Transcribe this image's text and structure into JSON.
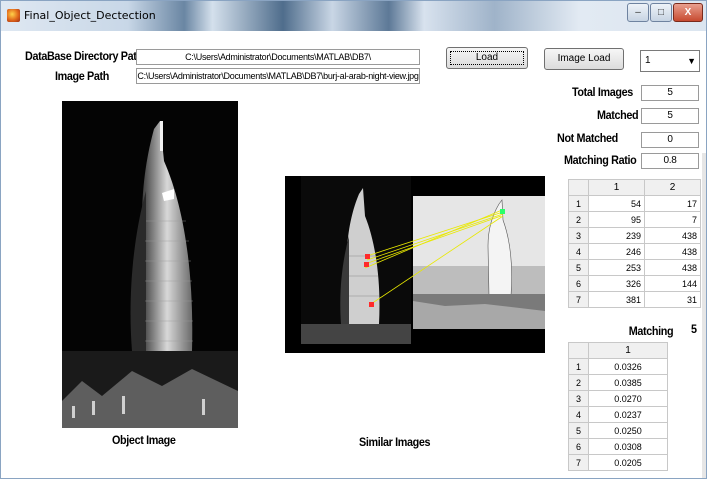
{
  "window": {
    "title": "Final_Object_Dectection",
    "minimize_label": "–",
    "maximize_label": "□",
    "close_label": "X"
  },
  "paths": {
    "db_label": "DataBase Directory Path",
    "db_value": "C:\\Users\\Administrator\\Documents\\MATLAB\\DB7\\",
    "image_label": "Image  Path",
    "image_value": "C:\\Users\\Administrator\\Documents\\MATLAB\\DB7\\burj-al-arab-night-view.jpg"
  },
  "buttons": {
    "load": "Load",
    "image_load": "Image Load"
  },
  "dropdown": {
    "selected": "1",
    "arrow": "▼"
  },
  "stats": {
    "total_label": "Total Images",
    "total_value": "5",
    "matched_label": "Matched",
    "matched_value": "5",
    "not_matched_label": "Not Matched",
    "not_matched_value": "0",
    "ratio_label": "Matching Ratio",
    "ratio_value": "0.8"
  },
  "coords_table": {
    "headers": [
      "",
      "1",
      "2"
    ],
    "rows": [
      [
        "1",
        "54",
        "17"
      ],
      [
        "2",
        "95",
        "7"
      ],
      [
        "3",
        "239",
        "438"
      ],
      [
        "4",
        "246",
        "438"
      ],
      [
        "5",
        "253",
        "438"
      ],
      [
        "6",
        "326",
        "144"
      ],
      [
        "7",
        "381",
        "31"
      ]
    ]
  },
  "matching": {
    "label": "Matching",
    "count": "5",
    "headers": [
      "",
      "1"
    ],
    "rows": [
      [
        "1",
        "0.0326"
      ],
      [
        "2",
        "0.0385"
      ],
      [
        "3",
        "0.0270"
      ],
      [
        "4",
        "0.0237"
      ],
      [
        "5",
        "0.0250"
      ],
      [
        "6",
        "0.0308"
      ],
      [
        "7",
        "0.0205"
      ]
    ]
  },
  "captions": {
    "object_image": "Object Image",
    "similar_images": "Similar  Images"
  },
  "colors": {
    "match_line": "#e8e800",
    "keypoint": "#ff2a2a",
    "keypoint_alt": "#2aff6a"
  }
}
